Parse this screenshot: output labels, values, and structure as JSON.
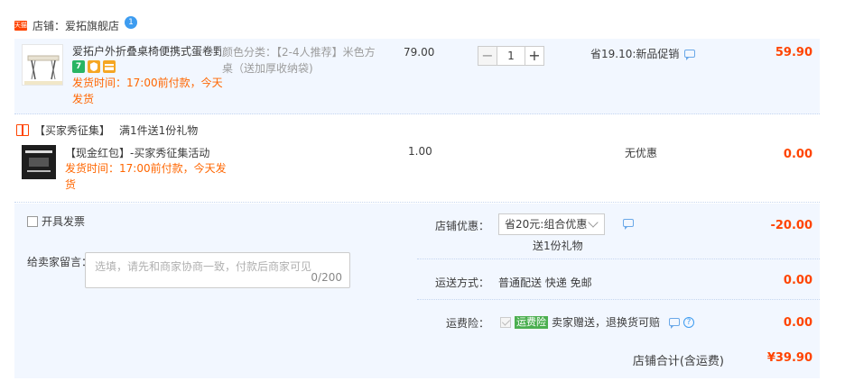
{
  "shop": {
    "logo_text": "天猫",
    "label": "店铺：",
    "name": "爱拓旗舰店",
    "chat_badge": "1"
  },
  "item1": {
    "title": "爱拓户外折叠桌椅便携式蛋卷野...",
    "badges": [
      "7",
      "",
      ""
    ],
    "ship_text": "发货时间：17:00前付款，今天发货",
    "sku": "颜色分类：【2-4人推荐】米色方桌（送加厚收纳袋)",
    "price": "79.00",
    "qty": "1",
    "qty_minus": "−",
    "qty_plus": "+",
    "promo": "省19.10:新品促销",
    "total": "59.90"
  },
  "gift": {
    "label": "【买家秀征集】",
    "rule": "满1件送1份礼物"
  },
  "item2": {
    "title": "【现金红包】-买家秀征集活动",
    "ship_text": "发货时间：17:00前付款，今天发货",
    "price": "1.00",
    "promo": "无优惠",
    "total": "0.00"
  },
  "invoice": {
    "label": "开具发票"
  },
  "message": {
    "label": "给卖家留言：",
    "placeholder": "选填，请先和商家协商一致，付款后商家可见",
    "count": "0/200"
  },
  "shop_discount": {
    "label": "店铺优惠：",
    "selected": "省20元:组合优惠",
    "note": "送1份礼物",
    "amount": "-20.00"
  },
  "shipping": {
    "label": "运送方式：",
    "value": "普通配送 快递 免邮",
    "amount": "0.00"
  },
  "insurance": {
    "label": "运费险：",
    "tag": "运费险",
    "value": "卖家赠送，退换货可赔",
    "amount": "0.00"
  },
  "footer": {
    "label": "店铺合计(含运费)",
    "total": "¥39.90"
  },
  "colors": {
    "accent": "#ff4400",
    "ship": "#ff6600",
    "panel": "#f2f7ff"
  }
}
